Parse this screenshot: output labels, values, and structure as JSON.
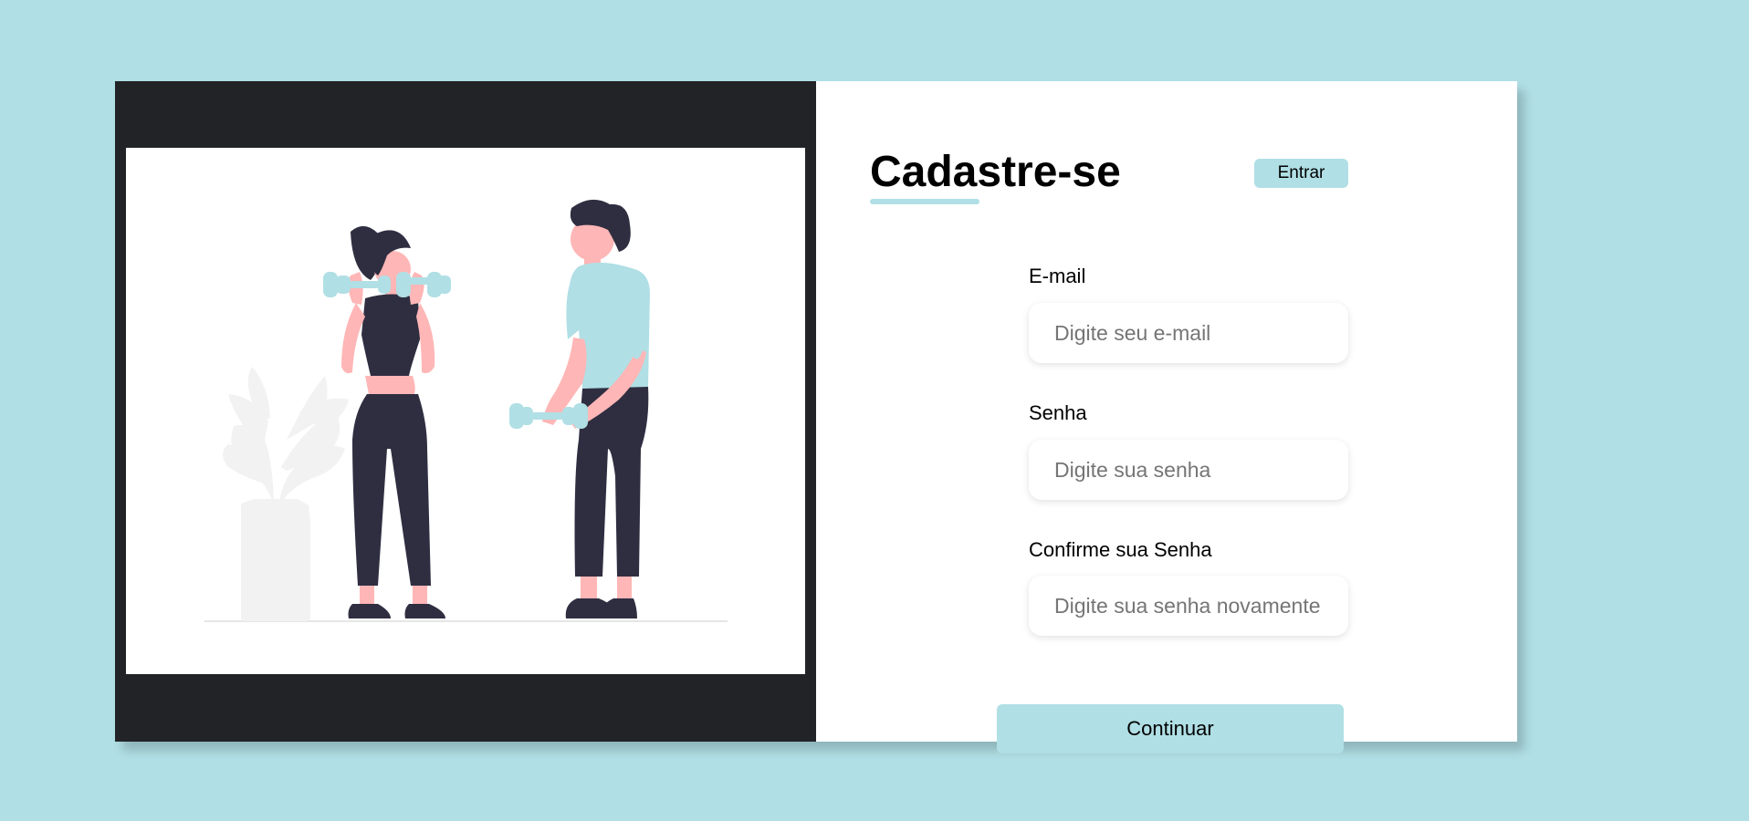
{
  "header": {
    "title": "Cadastre-se",
    "switch_label": "Entrar"
  },
  "form": {
    "fields": [
      {
        "label": "E-mail",
        "placeholder": "Digite seu e-mail",
        "value": ""
      },
      {
        "label": "Senha",
        "placeholder": "Digite sua senha",
        "value": ""
      },
      {
        "label": "Confirme sua Senha",
        "placeholder": "Digite sua senha novamente",
        "value": ""
      }
    ],
    "submit_label": "Continuar"
  },
  "illustration": {
    "icon": "fitness-people-illustration"
  },
  "colors": {
    "background": "#b0dfe5",
    "accent": "#b0dfe5",
    "image_panel": "#222327",
    "card": "#ffffff",
    "figure_dark": "#2f2e41",
    "skin": "#ffb6b6",
    "plant": "#f2f2f2"
  }
}
